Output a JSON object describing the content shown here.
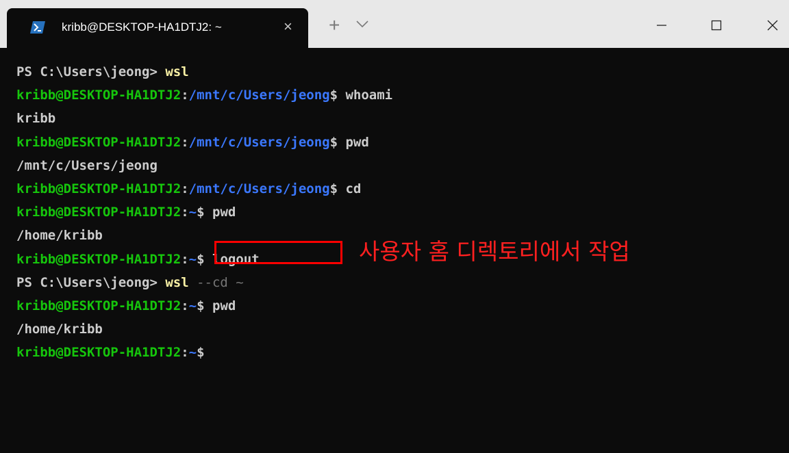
{
  "window": {
    "tab_title": "kribb@DESKTOP-HA1DTJ2: ~",
    "tab_close_label": "×",
    "new_tab_label": "+",
    "minimize_label": "—",
    "maximize_label": "☐",
    "close_label": "×"
  },
  "terminal": {
    "lines": [
      [
        {
          "text": "PS C:\\Users\\jeong> ",
          "c": "w"
        },
        {
          "text": "wsl",
          "c": "y"
        }
      ],
      [
        {
          "text": "kribb@DESKTOP-HA1DTJ2",
          "c": "g"
        },
        {
          "text": ":",
          "c": "w"
        },
        {
          "text": "/mnt/c/Users/jeong",
          "c": "b"
        },
        {
          "text": "$ whoami",
          "c": "w"
        }
      ],
      [
        {
          "text": "kribb",
          "c": "w"
        }
      ],
      [
        {
          "text": "kribb@DESKTOP-HA1DTJ2",
          "c": "g"
        },
        {
          "text": ":",
          "c": "w"
        },
        {
          "text": "/mnt/c/Users/jeong",
          "c": "b"
        },
        {
          "text": "$ pwd",
          "c": "w"
        }
      ],
      [
        {
          "text": "/mnt/c/Users/jeong",
          "c": "w"
        }
      ],
      [
        {
          "text": "kribb@DESKTOP-HA1DTJ2",
          "c": "g"
        },
        {
          "text": ":",
          "c": "w"
        },
        {
          "text": "/mnt/c/Users/jeong",
          "c": "b"
        },
        {
          "text": "$ cd",
          "c": "w"
        }
      ],
      [
        {
          "text": "kribb@DESKTOP-HA1DTJ2",
          "c": "g"
        },
        {
          "text": ":",
          "c": "w"
        },
        {
          "text": "~",
          "c": "b"
        },
        {
          "text": "$ pwd",
          "c": "w"
        }
      ],
      [
        {
          "text": "/home/kribb",
          "c": "w"
        }
      ],
      [
        {
          "text": "kribb@DESKTOP-HA1DTJ2",
          "c": "g"
        },
        {
          "text": ":",
          "c": "w"
        },
        {
          "text": "~",
          "c": "b"
        },
        {
          "text": "$ logout",
          "c": "w"
        }
      ],
      [
        {
          "text": "PS C:\\Users\\jeong> ",
          "c": "w"
        },
        {
          "text": "wsl",
          "c": "y"
        },
        {
          "text": " --cd ~",
          "c": "d"
        }
      ],
      [
        {
          "text": "kribb@DESKTOP-HA1DTJ2",
          "c": "g"
        },
        {
          "text": ":",
          "c": "w"
        },
        {
          "text": "~",
          "c": "b"
        },
        {
          "text": "$ pwd",
          "c": "w"
        }
      ],
      [
        {
          "text": "/home/kribb",
          "c": "w"
        }
      ],
      [
        {
          "text": "kribb@DESKTOP-HA1DTJ2",
          "c": "g"
        },
        {
          "text": ":",
          "c": "w"
        },
        {
          "text": "~",
          "c": "b"
        },
        {
          "text": "$",
          "c": "w"
        }
      ]
    ]
  },
  "annotation": {
    "text": "사용자 홈 디렉토리에서 작업",
    "color": "#ff2020"
  },
  "colors": {
    "prompt_user": "#16c60c",
    "prompt_path": "#3b78ff",
    "command": "#f9f1a5",
    "text": "#cccccc",
    "background": "#0c0c0c"
  }
}
